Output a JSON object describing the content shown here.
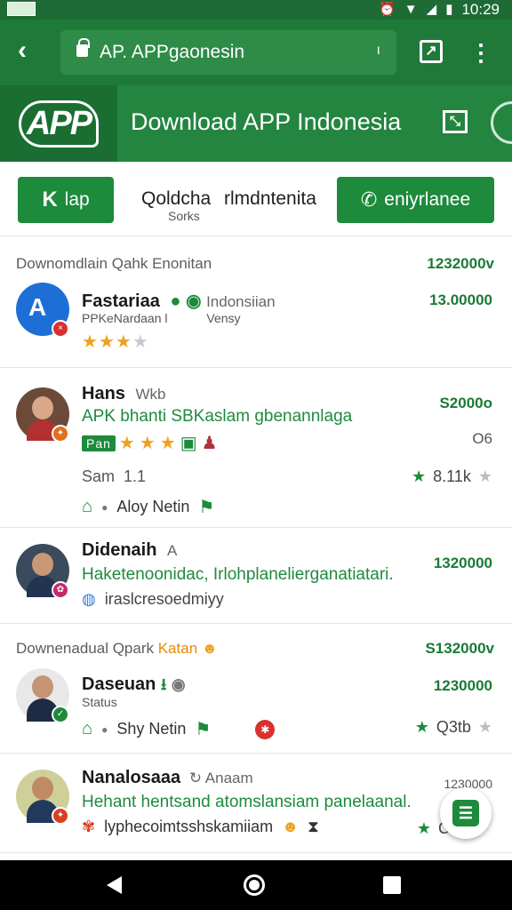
{
  "status_bar": {
    "time": "10:29"
  },
  "browser": {
    "url": "AP. APPgaonesin"
  },
  "header": {
    "logo_text": "APP",
    "title": "Download APP Indonesia"
  },
  "actions": {
    "left_button": "lap",
    "left_glyph": "K",
    "mid_title": "Qoldcha",
    "mid_subtitle": "Sorks",
    "mid_title2": "rlmdntenita",
    "right_button": "eniyrlanee"
  },
  "sections": [
    {
      "label": "Downomdlain Qahk Enonitan",
      "value": "1232000v"
    },
    {
      "label": "Downenadual Qpark",
      "label_accent": "Katan",
      "value": "S132000v"
    }
  ],
  "items": [
    {
      "name": "Fastariaa",
      "tag": "Indonsiian",
      "sub": "PPKeNardaan l",
      "sub2": "Vensy",
      "price": "13.00000",
      "stars": 3,
      "max_stars": 4
    },
    {
      "name": "Hans",
      "tag": "Wkb",
      "desc": "APK bhanti SBKaslam gbenannlaga",
      "pill": "Pan",
      "stars": 3,
      "price": "S2000o",
      "price2": "O6",
      "count_label": "Sam",
      "count_value": "1.1",
      "rating": "8.11k",
      "meta": "Aloy Netin"
    },
    {
      "name": "Didenaih",
      "tag": "A",
      "desc": "Haketenoonidac, Irlohplanelierganatiatari.",
      "sub": "iraslcresoedmiyy",
      "price": "1320000"
    },
    {
      "name": "Daseuan",
      "tag": "",
      "sub": "Status",
      "price": "1230000",
      "meta": "Shy Netin",
      "rating": "Q3tb"
    },
    {
      "name": "Nanalosaaa",
      "tag": "Anaam",
      "desc": "Hehant hentsand atomslansiam panelaanal.",
      "sub": "lyphecoimtsshskamiiam",
      "price": "1230000",
      "rating": "C"
    }
  ],
  "colors": {
    "primary": "#1f7a3a",
    "header": "#23853f",
    "accent": "#1d8a3c",
    "star": "#f0a020"
  }
}
